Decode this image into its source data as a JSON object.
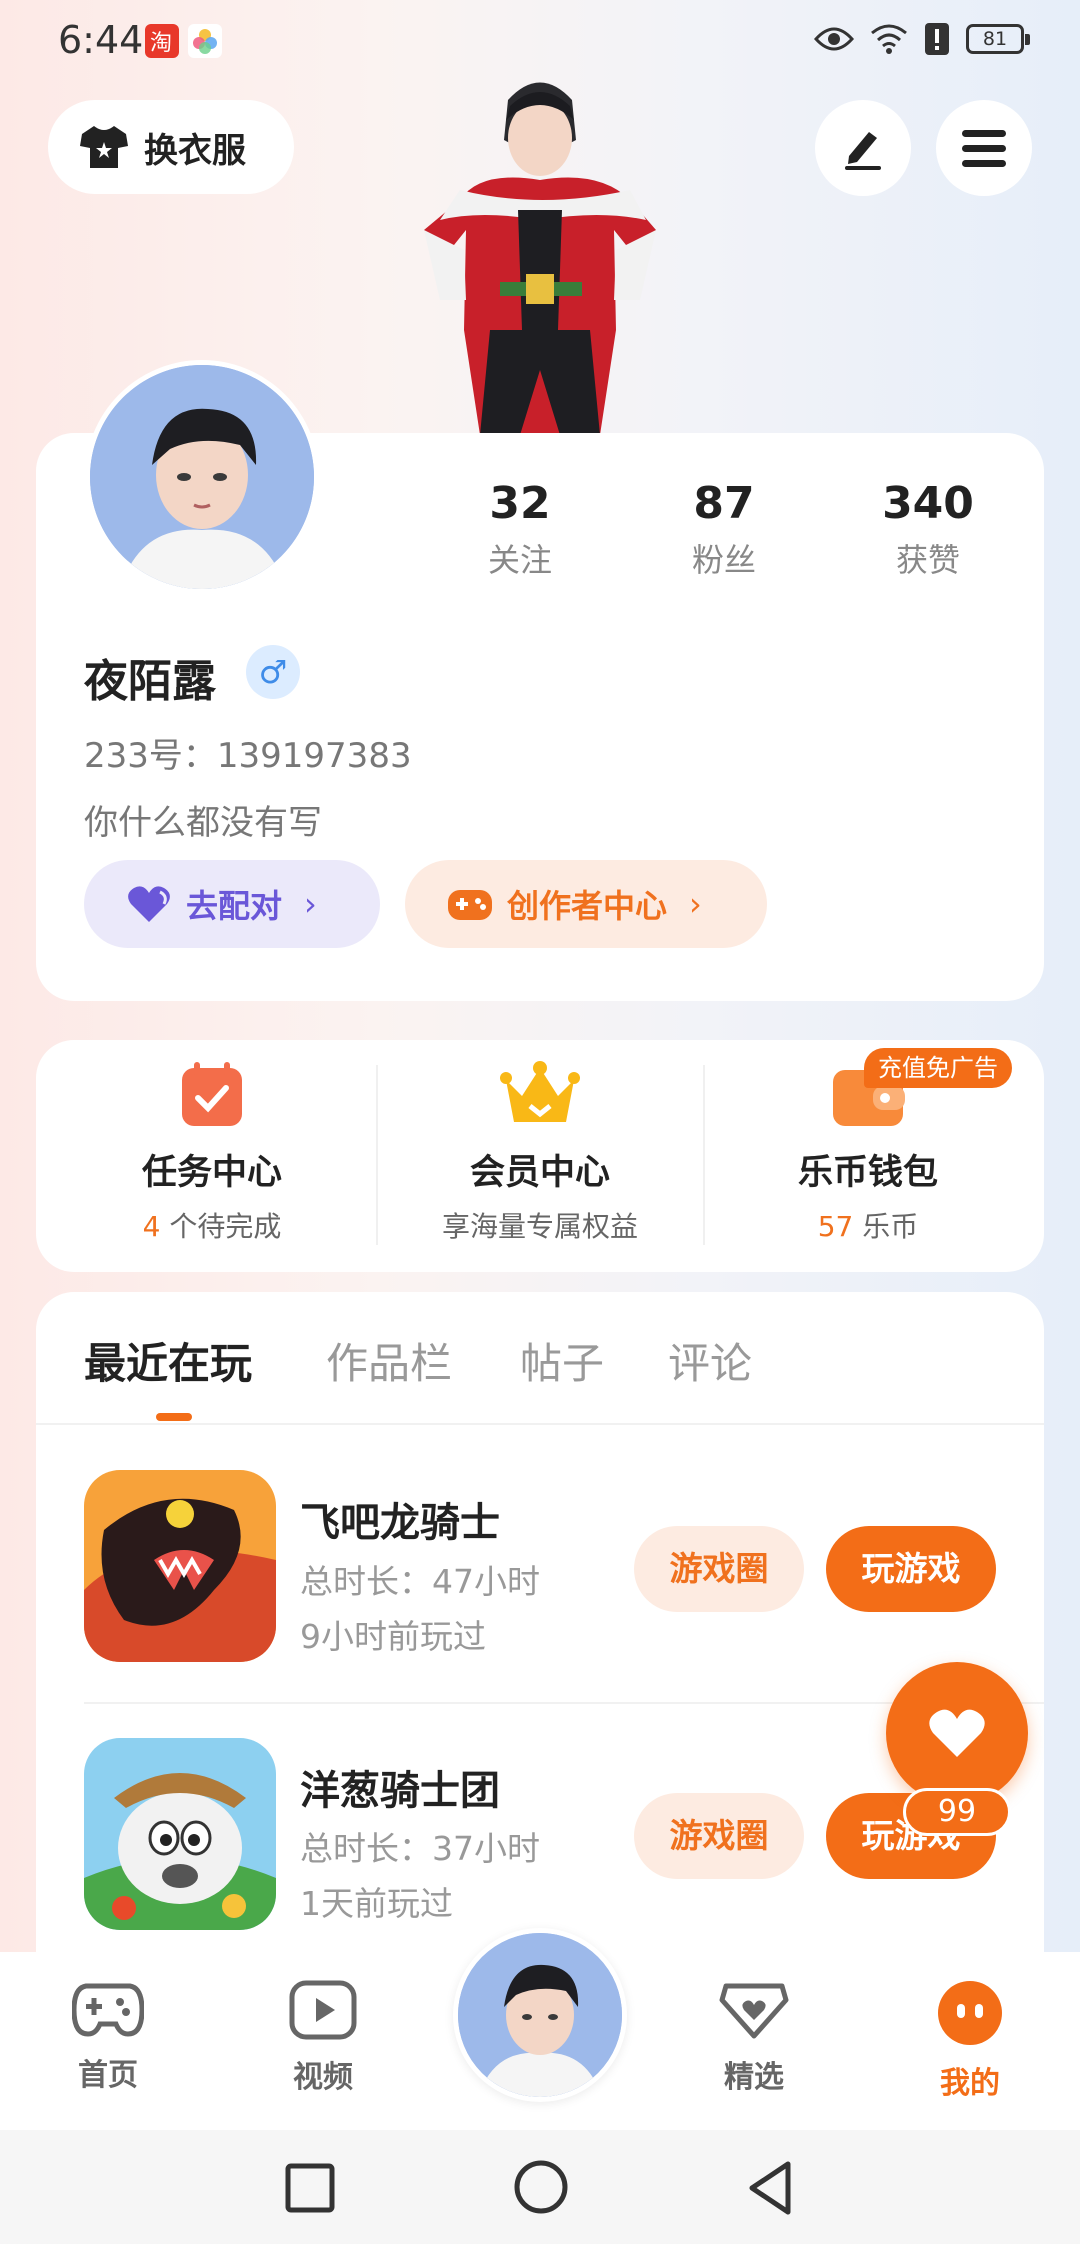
{
  "status_bar": {
    "time": "6:44",
    "battery": "81",
    "icons": [
      "taobao-app-icon",
      "photos-app-icon",
      "eye-icon",
      "wifi-icon",
      "alert-icon",
      "battery-icon"
    ]
  },
  "top_actions": {
    "dress_label": "换衣服",
    "icons": [
      "tshirt-icon",
      "edit-icon",
      "menu-icon"
    ]
  },
  "profile": {
    "stats": [
      {
        "value": "32",
        "label": "关注"
      },
      {
        "value": "87",
        "label": "粉丝"
      },
      {
        "value": "340",
        "label": "获赞"
      }
    ],
    "username": "夜陌露",
    "gender_symbol": "♂",
    "uid": "233号：139197383",
    "bio": "你什么都没有写",
    "match_label": "去配对",
    "creator_label": "创作者中心"
  },
  "functions": [
    {
      "title": "任务中心",
      "sub_highlight": "4",
      "sub_text": " 个待完成"
    },
    {
      "title": "会员中心",
      "sub_highlight": "",
      "sub_text": "享海量专属权益"
    },
    {
      "title": "乐币钱包",
      "sub_highlight": "57",
      "sub_text": " 乐币"
    }
  ],
  "recharge_badge": "充值免广告",
  "tabs": [
    "最近在玩",
    "作品栏",
    "帖子",
    "评论"
  ],
  "games": [
    {
      "name": "飞吧龙骑士",
      "duration": "总时长：47小时",
      "last_played": "9小时前玩过",
      "circle_label": "游戏圈",
      "play_label": "玩游戏"
    },
    {
      "name": "洋葱骑士团",
      "duration": "总时长：37小时",
      "last_played": "1天前玩过",
      "circle_label": "游戏圈",
      "play_label": "玩游戏"
    }
  ],
  "float_count": "99",
  "bottom_nav": [
    {
      "label": "首页",
      "active": false
    },
    {
      "label": "视频",
      "active": false
    },
    {
      "label": "精选",
      "active": false
    },
    {
      "label": "我的",
      "active": true
    }
  ],
  "colors": {
    "accent": "#f36d17",
    "purple": "#6a57d8",
    "gender_blue": "#3f8ce8"
  }
}
